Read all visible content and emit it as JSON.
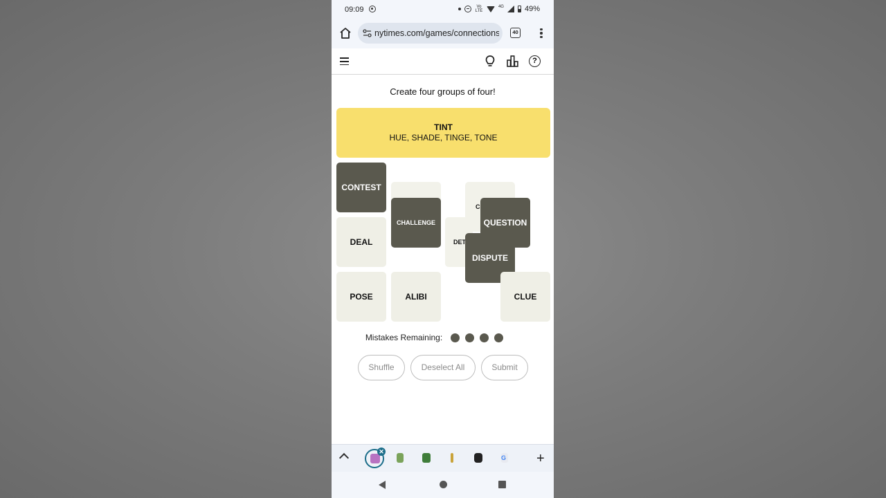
{
  "status_bar": {
    "time": "09:09",
    "battery": "49%",
    "volte": "Vo LTE",
    "network": "4G"
  },
  "browser": {
    "url": "nytimes.com/games/connections",
    "tab_count": "40"
  },
  "game": {
    "instruction": "Create four groups of four!",
    "solved_groups": [
      {
        "title": "TINT",
        "members": "HUE, SHADE, TINGE, TONE",
        "color": "#f8df6d"
      }
    ],
    "tiles": {
      "contest": "CONTEST",
      "challenge": "CHALLENGE",
      "question": "QUESTION",
      "dispute": "DISPUTE",
      "deal": "DEAL",
      "det_partial": "DET",
      "c_partial": "C",
      "pose": "POSE",
      "alibi": "ALIBI",
      "clue": "CLUE"
    },
    "mistakes_label": "Mistakes Remaining:",
    "mistakes_remaining": 4,
    "buttons": {
      "shuffle": "Shuffle",
      "deselect_all": "Deselect All",
      "submit": "Submit"
    }
  },
  "tabstrip": {
    "close_symbol": "✕",
    "new_tab_symbol": "+"
  },
  "colors": {
    "selected_tile": "#5a594e",
    "unselected_tile": "#efefe6",
    "yellow_group": "#f8df6d"
  }
}
